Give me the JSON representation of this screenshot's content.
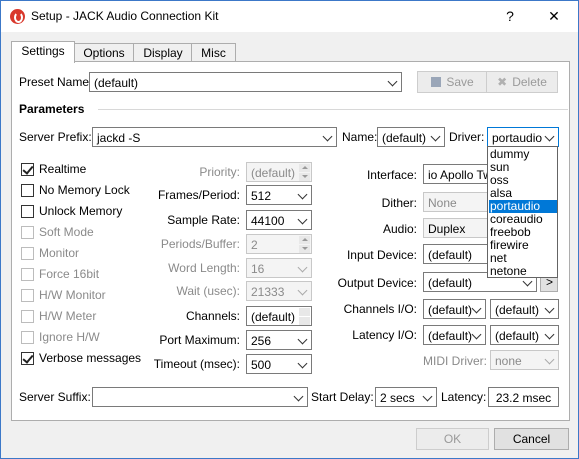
{
  "window": {
    "title": "Setup - JACK Audio Connection Kit",
    "help_glyph": "?",
    "close_glyph": "✕"
  },
  "tabs": [
    "Settings",
    "Options",
    "Display",
    "Misc"
  ],
  "preset": {
    "label": "Preset Name:",
    "value": "(default)",
    "save": "Save",
    "delete": "Delete"
  },
  "parameters": {
    "heading": "Parameters"
  },
  "server": {
    "prefix_label": "Server Prefix:",
    "prefix_value": "jackd -S",
    "name_label": "Name:",
    "name_value": "(default)",
    "driver_label": "Driver:",
    "driver_value": "portaudio"
  },
  "checkboxes": [
    {
      "label": "Realtime",
      "checked": true,
      "enabled": true
    },
    {
      "label": "No Memory Lock",
      "checked": false,
      "enabled": true
    },
    {
      "label": "Unlock Memory",
      "checked": false,
      "enabled": true
    },
    {
      "label": "Soft Mode",
      "checked": false,
      "enabled": false
    },
    {
      "label": "Monitor",
      "checked": false,
      "enabled": false
    },
    {
      "label": "Force 16bit",
      "checked": false,
      "enabled": false
    },
    {
      "label": "H/W Monitor",
      "checked": false,
      "enabled": false
    },
    {
      "label": "H/W Meter",
      "checked": false,
      "enabled": false
    },
    {
      "label": "Ignore H/W",
      "checked": false,
      "enabled": false
    },
    {
      "label": "Verbose messages",
      "checked": true,
      "enabled": true
    }
  ],
  "middle": [
    {
      "label": "Priority:",
      "value": "(default)",
      "kind": "spin",
      "enabled": false
    },
    {
      "label": "Frames/Period:",
      "value": "512",
      "kind": "combo",
      "enabled": true
    },
    {
      "label": "Sample Rate:",
      "value": "44100",
      "kind": "combo",
      "enabled": true
    },
    {
      "label": "Periods/Buffer:",
      "value": "2",
      "kind": "spin",
      "enabled": false
    },
    {
      "label": "Word Length:",
      "value": "16",
      "kind": "combo",
      "enabled": false
    },
    {
      "label": "Wait (usec):",
      "value": "21333",
      "kind": "combo",
      "enabled": false
    },
    {
      "label": "Channels:",
      "value": "(default)",
      "kind": "spin",
      "enabled": true
    },
    {
      "label": "Port Maximum:",
      "value": "256",
      "kind": "combo",
      "enabled": true
    },
    {
      "label": "Timeout (msec):",
      "value": "500",
      "kind": "combo",
      "enabled": true
    }
  ],
  "right": {
    "interface_label": "Interface:",
    "interface_value": "io Apollo Twin",
    "dither_label": "Dither:",
    "dither_value": "None",
    "audio_label": "Audio:",
    "audio_value": "Duplex",
    "input_label": "Input Device:",
    "input_value": "(default)",
    "output_label": "Output Device:",
    "output_value": "(default)",
    "channels_io_label": "Channels I/O:",
    "channels_in": "(default)",
    "channels_out": "(default)",
    "latency_io_label": "Latency I/O:",
    "latency_in": "(default)",
    "latency_out": "(default)",
    "midi_label": "MIDI Driver:",
    "midi_value": "none",
    "more_glyph": ">"
  },
  "driver_options": [
    "dummy",
    "sun",
    "oss",
    "alsa",
    "portaudio",
    "coreaudio",
    "freebob",
    "firewire",
    "net",
    "netone"
  ],
  "driver_selected_index": 4,
  "bottom": {
    "suffix_label": "Server Suffix:",
    "suffix_value": "",
    "start_delay_label": "Start Delay:",
    "start_delay_value": "2 secs",
    "latency_label": "Latency:",
    "latency_value": "23.2 msec"
  },
  "footer": {
    "ok": "OK",
    "cancel": "Cancel"
  }
}
